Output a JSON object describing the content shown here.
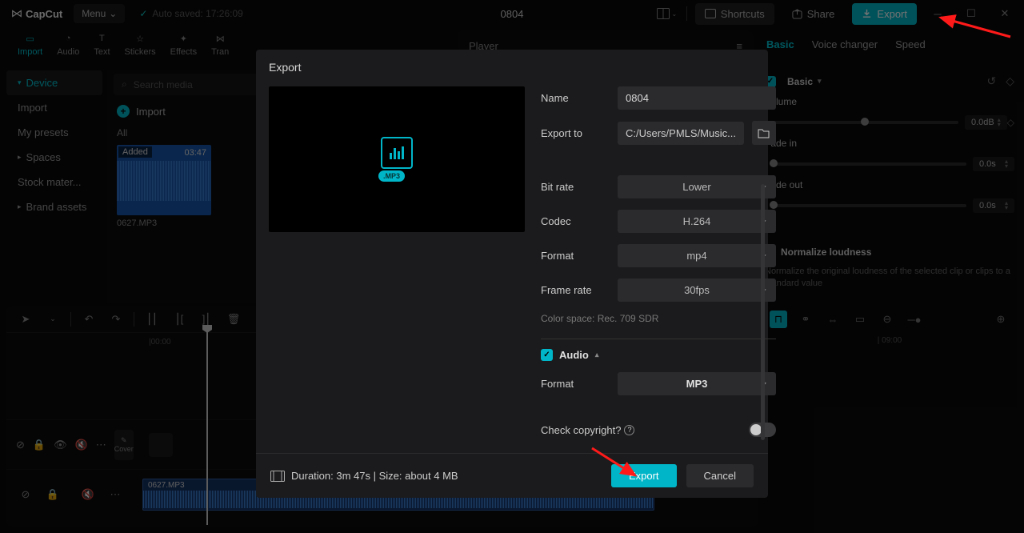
{
  "titlebar": {
    "app": "CapCut",
    "menu": "Menu",
    "autosave": "Auto saved: 17:26:09",
    "project": "0804",
    "shortcuts": "Shortcuts",
    "share": "Share",
    "export": "Export"
  },
  "top_tabs": {
    "import": "Import",
    "audio": "Audio",
    "text": "Text",
    "stickers": "Stickers",
    "effects": "Effects",
    "transitions": "Tran"
  },
  "left_nav": {
    "device": "Device",
    "import": "Import",
    "presets": "My presets",
    "spaces": "Spaces",
    "stock": "Stock mater...",
    "brand": "Brand assets"
  },
  "media": {
    "search_ph": "Search media",
    "import": "Import",
    "all": "All",
    "clip_badge": "Added",
    "clip_dur": "03:47",
    "clip_name": "0627.MP3"
  },
  "player": {
    "title": "Player"
  },
  "right": {
    "tab_basic": "Basic",
    "tab_voice": "Voice changer",
    "tab_speed": "Speed",
    "basic_label": "Basic",
    "volume": "Volume",
    "volume_val": "0.0dB",
    "fadein": "Fade in",
    "fadein_val": "0.0s",
    "fadeout": "Fade out",
    "fadeout_val": "0.0s",
    "normalize": "Normalize loudness",
    "normalize_desc": "Normalize the original loudness of the selected clip or clips to a standard value"
  },
  "timeline": {
    "ruler_0": "|00:00",
    "ruler_9": "| 09:00",
    "cover": "Cover",
    "clip": "0627.MP3"
  },
  "export": {
    "title": "Export",
    "name_lbl": "Name",
    "name_val": "0804",
    "to_lbl": "Export to",
    "to_val": "C:/Users/PMLS/Music...",
    "bitrate_lbl": "Bit rate",
    "bitrate_val": "Lower",
    "codec_lbl": "Codec",
    "codec_val": "H.264",
    "format_lbl": "Format",
    "format_val": "mp4",
    "fps_lbl": "Frame rate",
    "fps_val": "30fps",
    "colorspace": "Color space: Rec. 709 SDR",
    "audio_hdr": "Audio",
    "afmt_lbl": "Format",
    "afmt_val": "MP3",
    "copyright": "Check copyright?",
    "mp3_tag": ".MP3",
    "footer_info": "Duration: 3m 47s | Size: about 4 MB",
    "btn_export": "Export",
    "btn_cancel": "Cancel"
  }
}
